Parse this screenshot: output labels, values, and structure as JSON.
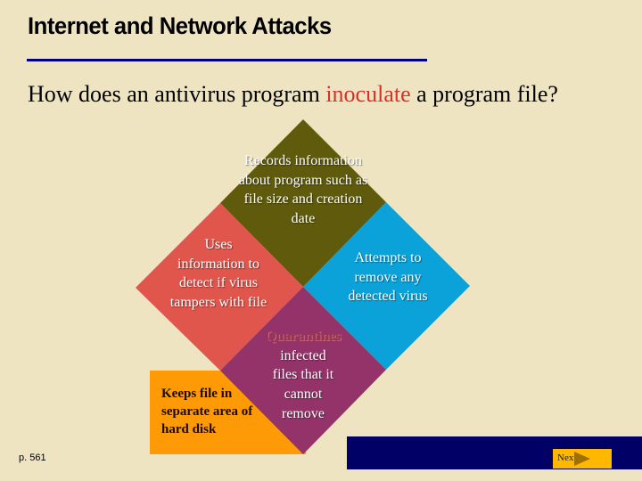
{
  "header": {
    "title": "Internet and Network Attacks"
  },
  "question": {
    "before": "How does an antivirus program ",
    "highlight": "inoculate",
    "after": " a program file?"
  },
  "diagram": {
    "records": "Records information about program such as file size and creation date",
    "uses": "Uses information to detect if virus tampers with file",
    "attempts": "Attempts to remove any detected virus",
    "quarantines_word": "Quarantines",
    "quarantines_rest": "infected files that it cannot remove",
    "keeps": "Keeps file in separate area of hard disk",
    "colors": {
      "records": "#5f5a0c",
      "uses": "#e0564c",
      "attempts": "#0aa2d8",
      "quarantines": "#93336a",
      "keeps": "#fd9a06"
    }
  },
  "footer": {
    "page": "p. 561",
    "next_label": "Next",
    "next_icon": "play-arrow-icon"
  }
}
